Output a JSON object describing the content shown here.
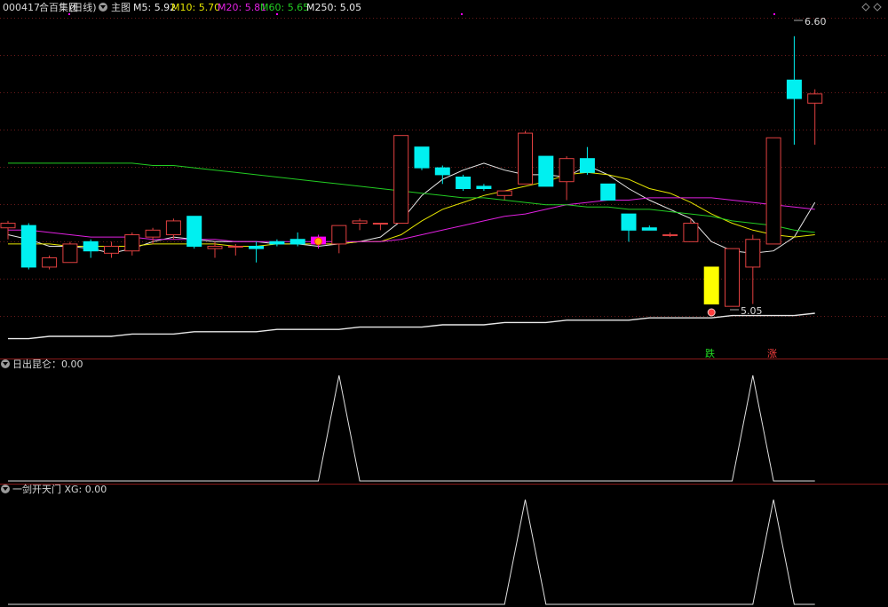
{
  "header": {
    "code": "000417",
    "name": "合百集团",
    "period": "(日线)",
    "main_label": "主图",
    "ma": [
      {
        "label": "M5:",
        "value": "5.92",
        "color": "#e8e8e8"
      },
      {
        "label": "M10:",
        "value": "5.70",
        "color": "#e6e600"
      },
      {
        "label": "M20:",
        "value": "5.81",
        "color": "#e020e0"
      },
      {
        "label": "M60:",
        "value": "5.65",
        "color": "#22cc22"
      },
      {
        "label": "M250:",
        "value": "5.05",
        "color": "#e8e8e8"
      }
    ]
  },
  "panels": {
    "p1_title": "日出昆仑：0.00",
    "p2_title": "一剑开天门 XG: 0.00"
  },
  "annotations": {
    "high_label": "6.60",
    "low_label": "5.05",
    "mark_die": "跌",
    "mark_zhang": "涨"
  },
  "colors": {
    "up": "#e04040",
    "down": "#00f0f0",
    "grid": "#6a1a1a",
    "special_bar": "#ffff00",
    "special_box": "#ff00ff"
  },
  "chart_data": [
    {
      "type": "candlestick",
      "title": "合百集团 (日线)",
      "x": [
        1,
        2,
        3,
        4,
        5,
        6,
        7,
        8,
        9,
        10,
        11,
        12,
        13,
        14,
        15,
        16,
        17,
        18,
        19,
        20,
        21,
        22,
        23,
        24,
        25,
        26,
        27,
        28,
        29,
        30,
        31,
        32,
        33,
        34,
        35,
        36,
        37,
        38,
        39
      ],
      "candles": [
        {
          "o": 5.77,
          "h": 5.8,
          "l": 5.72,
          "c": 5.79
        },
        {
          "o": 5.78,
          "h": 5.79,
          "l": 5.59,
          "c": 5.6
        },
        {
          "o": 5.6,
          "h": 5.65,
          "l": 5.59,
          "c": 5.64
        },
        {
          "o": 5.62,
          "h": 5.71,
          "l": 5.62,
          "c": 5.7
        },
        {
          "o": 5.71,
          "h": 5.72,
          "l": 5.64,
          "c": 5.67
        },
        {
          "o": 5.66,
          "h": 5.71,
          "l": 5.64,
          "c": 5.69
        },
        {
          "o": 5.67,
          "h": 5.75,
          "l": 5.65,
          "c": 5.74
        },
        {
          "o": 5.73,
          "h": 5.77,
          "l": 5.7,
          "c": 5.76
        },
        {
          "o": 5.74,
          "h": 5.81,
          "l": 5.72,
          "c": 5.8
        },
        {
          "o": 5.82,
          "h": 5.82,
          "l": 5.68,
          "c": 5.69
        },
        {
          "o": 5.68,
          "h": 5.71,
          "l": 5.64,
          "c": 5.69
        },
        {
          "o": 5.69,
          "h": 5.7,
          "l": 5.65,
          "c": 5.69
        },
        {
          "o": 5.69,
          "h": 5.71,
          "l": 5.62,
          "c": 5.68
        },
        {
          "o": 5.71,
          "h": 5.72,
          "l": 5.69,
          "c": 5.7
        },
        {
          "o": 5.72,
          "h": 5.75,
          "l": 5.69,
          "c": 5.7
        },
        {
          "o": 5.73,
          "h": 5.74,
          "l": 5.68,
          "c": 5.7
        },
        {
          "o": 5.7,
          "h": 5.78,
          "l": 5.66,
          "c": 5.78
        },
        {
          "o": 5.79,
          "h": 5.81,
          "l": 5.76,
          "c": 5.8
        },
        {
          "o": 5.79,
          "h": 5.79,
          "l": 5.76,
          "c": 5.79
        },
        {
          "o": 5.79,
          "h": 6.17,
          "l": 5.79,
          "c": 6.17
        },
        {
          "o": 6.12,
          "h": 6.12,
          "l": 6.02,
          "c": 6.03
        },
        {
          "o": 6.03,
          "h": 6.04,
          "l": 5.96,
          "c": 6.0
        },
        {
          "o": 5.99,
          "h": 6.0,
          "l": 5.93,
          "c": 5.94
        },
        {
          "o": 5.95,
          "h": 5.96,
          "l": 5.93,
          "c": 5.94
        },
        {
          "o": 5.91,
          "h": 5.93,
          "l": 5.89,
          "c": 5.93
        },
        {
          "o": 5.96,
          "h": 6.19,
          "l": 5.96,
          "c": 6.18
        },
        {
          "o": 6.08,
          "h": 6.08,
          "l": 5.95,
          "c": 5.95
        },
        {
          "o": 5.97,
          "h": 6.08,
          "l": 5.89,
          "c": 6.07
        },
        {
          "o": 6.07,
          "h": 6.12,
          "l": 6.0,
          "c": 6.01
        },
        {
          "o": 5.96,
          "h": 5.96,
          "l": 5.89,
          "c": 5.89
        },
        {
          "o": 5.83,
          "h": 5.83,
          "l": 5.71,
          "c": 5.76
        },
        {
          "o": 5.77,
          "h": 5.78,
          "l": 5.76,
          "c": 5.76
        },
        {
          "o": 5.74,
          "h": 5.75,
          "l": 5.73,
          "c": 5.74
        },
        {
          "o": 5.71,
          "h": 5.81,
          "l": 5.71,
          "c": 5.79
        },
        {
          "o": 5.6,
          "h": 5.6,
          "l": 5.44,
          "c": 5.44
        },
        {
          "o": 5.43,
          "h": 5.68,
          "l": 5.43,
          "c": 5.68
        },
        {
          "o": 5.6,
          "h": 5.74,
          "l": 5.44,
          "c": 5.72
        },
        {
          "o": 5.7,
          "h": 6.16,
          "l": 5.7,
          "c": 6.16
        },
        {
          "o": 6.41,
          "h": 6.6,
          "l": 6.13,
          "c": 6.33
        },
        {
          "o": 6.31,
          "h": 6.37,
          "l": 6.13,
          "c": 6.35
        }
      ],
      "special": {
        "yellow_bar_index": 34,
        "magenta_box_index": 15
      },
      "series": [
        {
          "name": "M5",
          "values": [
            5.74,
            5.72,
            5.69,
            5.69,
            5.68,
            5.66,
            5.68,
            5.71,
            5.73,
            5.72,
            5.71,
            5.71,
            5.71,
            5.7,
            5.7,
            5.69,
            5.7,
            5.71,
            5.73,
            5.8,
            5.91,
            5.98,
            6.02,
            6.05,
            6.02,
            6.0,
            6.0,
            5.99,
            6.04,
            6.0,
            5.94,
            5.89,
            5.85,
            5.81,
            5.71,
            5.67,
            5.66,
            5.67,
            5.73,
            5.88,
            5.92
          ]
        },
        {
          "name": "M10",
          "values": [
            5.7,
            5.7,
            5.7,
            5.69,
            5.69,
            5.69,
            5.69,
            5.7,
            5.7,
            5.7,
            5.7,
            5.69,
            5.69,
            5.7,
            5.7,
            5.7,
            5.7,
            5.71,
            5.71,
            5.74,
            5.8,
            5.85,
            5.88,
            5.91,
            5.93,
            5.95,
            5.97,
            6.0,
            6.01,
            6.0,
            5.98,
            5.94,
            5.92,
            5.88,
            5.83,
            5.79,
            5.76,
            5.74,
            5.73,
            5.74,
            5.7
          ]
        },
        {
          "name": "M20",
          "values": [
            5.76,
            5.76,
            5.75,
            5.74,
            5.73,
            5.73,
            5.73,
            5.72,
            5.72,
            5.72,
            5.72,
            5.71,
            5.71,
            5.71,
            5.71,
            5.71,
            5.71,
            5.71,
            5.71,
            5.72,
            5.74,
            5.76,
            5.78,
            5.8,
            5.82,
            5.83,
            5.85,
            5.87,
            5.88,
            5.89,
            5.89,
            5.9,
            5.9,
            5.9,
            5.9,
            5.89,
            5.88,
            5.87,
            5.86,
            5.85,
            5.81
          ]
        },
        {
          "name": "M60",
          "values": [
            6.05,
            6.05,
            6.05,
            6.05,
            6.05,
            6.05,
            6.05,
            6.04,
            6.04,
            6.03,
            6.02,
            6.01,
            6.0,
            5.99,
            5.98,
            5.97,
            5.96,
            5.95,
            5.94,
            5.93,
            5.92,
            5.91,
            5.9,
            5.9,
            5.89,
            5.88,
            5.87,
            5.87,
            5.86,
            5.86,
            5.85,
            5.85,
            5.84,
            5.83,
            5.82,
            5.8,
            5.79,
            5.78,
            5.76,
            5.75,
            5.65
          ]
        },
        {
          "name": "M250",
          "values": [
            5.29,
            5.29,
            5.3,
            5.3,
            5.3,
            5.3,
            5.31,
            5.31,
            5.31,
            5.32,
            5.32,
            5.32,
            5.32,
            5.33,
            5.33,
            5.33,
            5.33,
            5.34,
            5.34,
            5.34,
            5.34,
            5.35,
            5.35,
            5.35,
            5.36,
            5.36,
            5.36,
            5.37,
            5.37,
            5.37,
            5.37,
            5.38,
            5.38,
            5.38,
            5.38,
            5.39,
            5.39,
            5.39,
            5.39,
            5.4,
            5.05
          ]
        }
      ],
      "ylim": [
        5.25,
        6.68
      ]
    },
    {
      "type": "line",
      "title": "日出昆仑",
      "series": [
        {
          "name": "日出昆仑",
          "values": [
            0,
            0,
            0,
            0,
            0,
            0,
            0,
            0,
            0,
            0,
            0,
            0,
            0,
            0,
            0,
            0,
            1,
            0,
            0,
            0,
            0,
            0,
            0,
            0,
            0,
            0,
            0,
            0,
            0,
            0,
            0,
            0,
            0,
            0,
            0,
            0,
            1,
            0,
            0,
            0
          ]
        }
      ],
      "ylim": [
        0,
        1
      ]
    },
    {
      "type": "line",
      "title": "一剑开天门 XG",
      "series": [
        {
          "name": "XG",
          "values": [
            0,
            0,
            0,
            0,
            0,
            0,
            0,
            0,
            0,
            0,
            0,
            0,
            0,
            0,
            0,
            0,
            0,
            0,
            0,
            0,
            0,
            0,
            0,
            0,
            0,
            1,
            0,
            0,
            0,
            0,
            0,
            0,
            0,
            0,
            0,
            0,
            0,
            1,
            0,
            0
          ]
        }
      ],
      "ylim": [
        0,
        1
      ]
    }
  ]
}
